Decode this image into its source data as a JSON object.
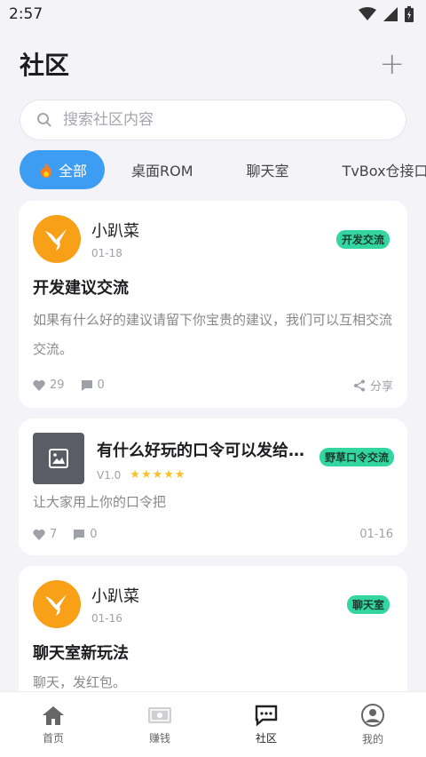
{
  "status_bar": {
    "time": "2:57"
  },
  "header": {
    "title": "社区",
    "add_label": "+"
  },
  "search": {
    "placeholder": "搜索社区内容"
  },
  "tabs": [
    {
      "label": "全部"
    },
    {
      "label": "桌面ROM"
    },
    {
      "label": "聊天室"
    },
    {
      "label": "TvBox仓接口"
    }
  ],
  "posts": [
    {
      "user": "小趴菜",
      "date": "01-18",
      "tag": "开发交流",
      "title": "开发建议交流",
      "body": "如果有什么好的建议请留下你宝贵的建议，我们可以互相交流交流。",
      "likes": "29",
      "comments": "0",
      "share_label": "分享"
    },
    {
      "title": "有什么好玩的口令可以发给我...",
      "version": "V1.0",
      "stars": "★★★★★",
      "rating": 5,
      "tag": "野草口令交流",
      "body": "让大家用上你的口令把",
      "likes": "7",
      "comments": "0",
      "date": "01-16"
    },
    {
      "user": "小趴菜",
      "date": "01-16",
      "tag": "聊天室",
      "title": "聊天室新玩法",
      "body": "聊天，发红包。"
    }
  ],
  "bottom_nav": [
    {
      "label": "首页"
    },
    {
      "label": "赚钱"
    },
    {
      "label": "社区"
    },
    {
      "label": "我的"
    }
  ],
  "colors": {
    "accent": "#3d9df3",
    "tag": "#33d6a0",
    "avatar": "#f7a018"
  }
}
